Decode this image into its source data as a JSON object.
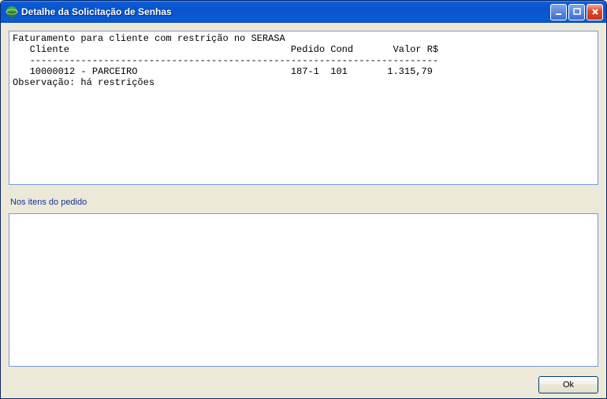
{
  "window": {
    "title": "Detalhe da Solicitação de Senhas"
  },
  "top_panel": {
    "header_line": "Faturamento para cliente com restrição no SERASA",
    "columns_line": "   Cliente                                       Pedido Cond       Valor R$",
    "divider_line": "   ------------------------------------------------------------------------",
    "row_line": "   10000012 - PARCEIRO                           187-1  101       1.315,79",
    "observation_line": "Observação: há restrições"
  },
  "section_label": "Nos itens do pedido",
  "buttons": {
    "ok": "Ok"
  }
}
